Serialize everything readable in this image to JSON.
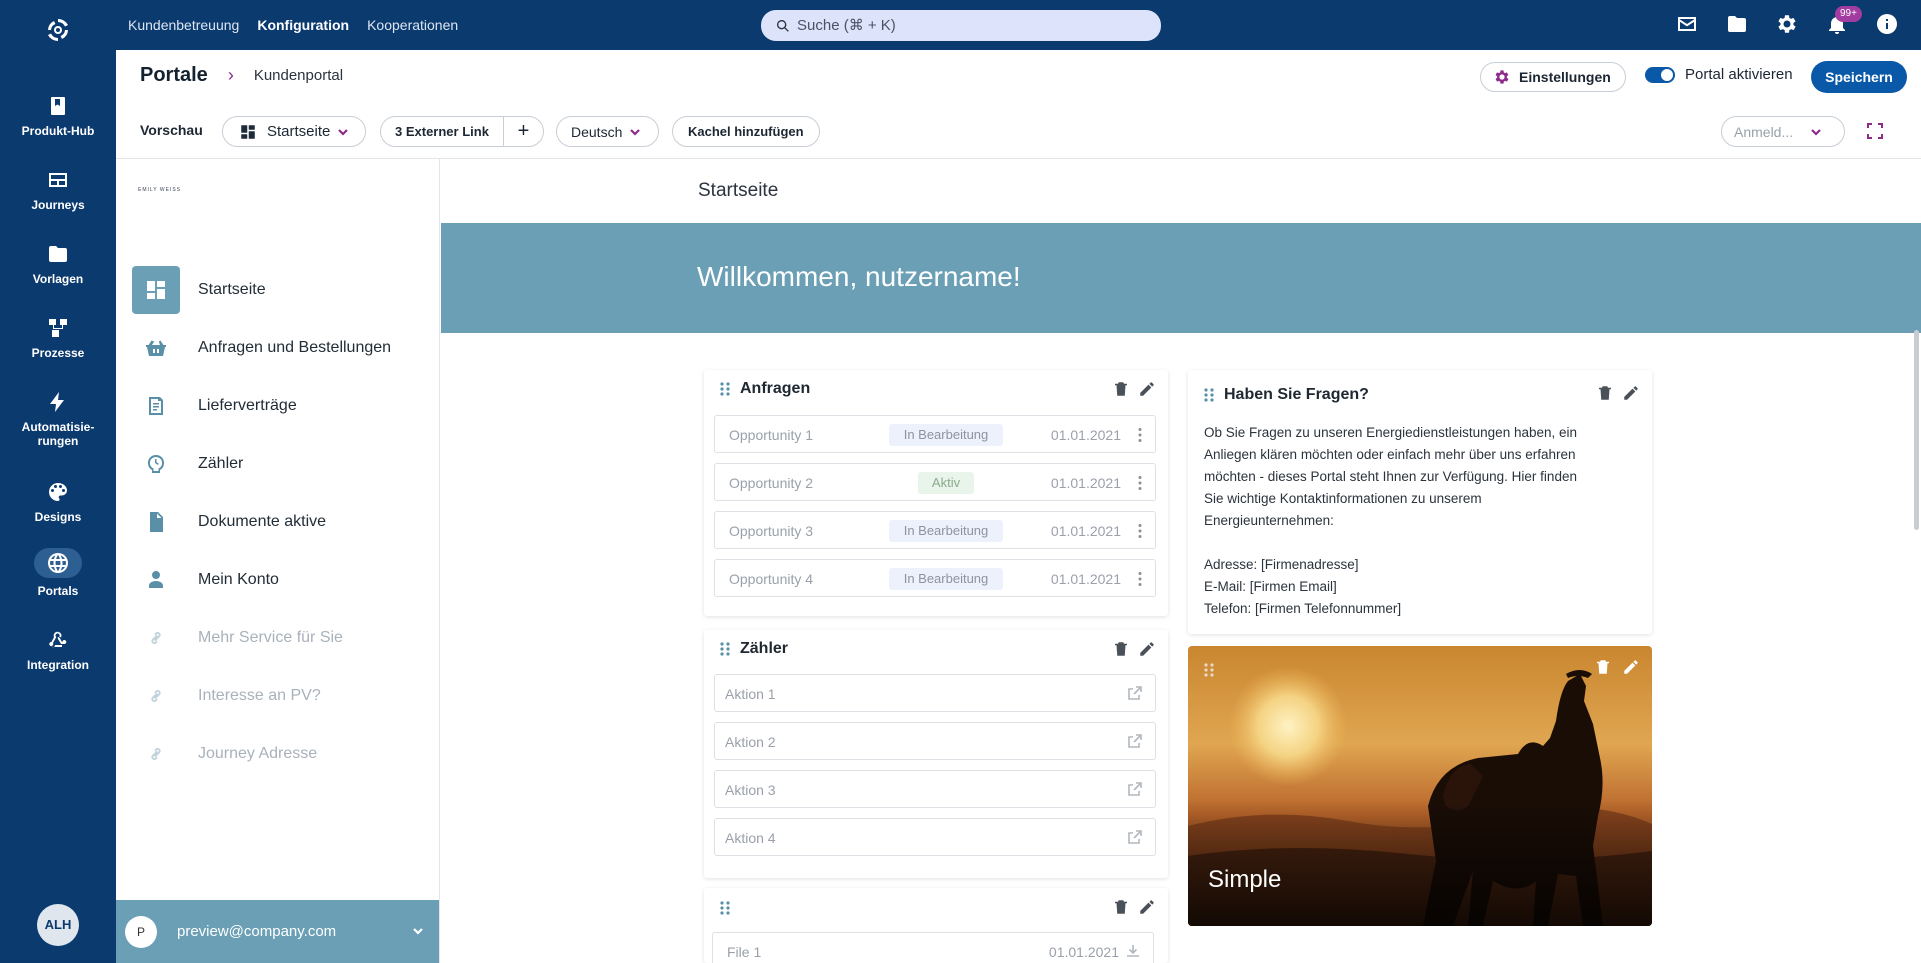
{
  "rail": {
    "items": [
      {
        "label": "Produkt-Hub",
        "icon": "book-icon"
      },
      {
        "label": "Journeys",
        "icon": "journeys-icon"
      },
      {
        "label": "Vorlagen",
        "icon": "folder-icon"
      },
      {
        "label": "Prozesse",
        "icon": "process-icon"
      },
      {
        "label": "Automatisie-",
        "label2": "rungen",
        "icon": "bolt-icon"
      },
      {
        "label": "Designs",
        "icon": "palette-icon"
      },
      {
        "label": "Portals",
        "icon": "globe-icon"
      },
      {
        "label": "Integration",
        "icon": "webhook-icon"
      }
    ],
    "avatar": "ALH"
  },
  "topnav": {
    "items": [
      "Kundenbetreuung",
      "Konfiguration",
      "Kooperationen"
    ],
    "active": "Konfiguration",
    "search_placeholder": "Suche (⌘ + K)",
    "notification_count": "99+"
  },
  "header": {
    "breadcrumb_root": "Portale",
    "breadcrumb_leaf": "Kundenportal",
    "settings_label": "Einstellungen",
    "toggle_label": "Portal aktivieren",
    "save_label": "Speichern"
  },
  "toolbar": {
    "preview_label": "Vorschau",
    "page_select": "Startseite",
    "links_label": "3 Externer Link",
    "add_symbol": "+",
    "language": "Deutsch",
    "add_tile_label": "Kachel hinzufügen",
    "login_placeholder": "Anmeld..."
  },
  "portal_sidebar": {
    "logo_text": "EMILY WEISS",
    "items": [
      {
        "label": "Startseite",
        "active": true
      },
      {
        "label": "Anfragen und Bestellungen"
      },
      {
        "label": "Lieferverträge"
      },
      {
        "label": "Zähler"
      },
      {
        "label": "Dokumente aktive"
      },
      {
        "label": "Mein Konto"
      },
      {
        "label": "Mehr Service für Sie",
        "muted": true
      },
      {
        "label": "Interesse an PV?",
        "muted": true
      },
      {
        "label": "Journey Adresse",
        "muted": true
      }
    ],
    "footer_initial": "P",
    "footer_email": "preview@company.com"
  },
  "preview": {
    "page_title": "Startseite",
    "banner_text": "Willkommen, nutzername!",
    "anfragen": {
      "title": "Anfragen",
      "rows": [
        {
          "name": "Opportunity 1",
          "status": "In Bearbeitung",
          "date": "01.01.2021"
        },
        {
          "name": "Opportunity 2",
          "status": "Aktiv",
          "date": "01.01.2021"
        },
        {
          "name": "Opportunity 3",
          "status": "In Bearbeitung",
          "date": "01.01.2021"
        },
        {
          "name": "Opportunity 4",
          "status": "In Bearbeitung",
          "date": "01.01.2021"
        }
      ]
    },
    "zaehler": {
      "title": "Zähler",
      "rows": [
        "Aktion 1",
        "Aktion 2",
        "Aktion 3",
        "Aktion 4"
      ]
    },
    "files": {
      "rows": [
        {
          "name": "File 1",
          "date": "01.01.2021"
        }
      ]
    },
    "faq": {
      "title": "Haben Sie Fragen?",
      "lines": [
        "Ob Sie Fragen zu unseren Energiedienstleistungen haben, ein",
        "Anliegen klären möchten oder einfach mehr über uns erfahren",
        "möchten - dieses Portal steht Ihnen zur Verfügung. Hier finden",
        "Sie wichtige Kontaktinformationen zu unserem",
        "Energieunternehmen:",
        "",
        "Adresse: [Firmenadresse]",
        "E-Mail: [Firmen Email]",
        "Telefon: [Firmen Telefonnummer]"
      ]
    },
    "image_card": {
      "caption": "Simple"
    }
  },
  "colors": {
    "navy": "#0b3a6f",
    "accent": "#0a58a8",
    "purple": "#8d2b8b",
    "teal": "#6a9fb5"
  }
}
